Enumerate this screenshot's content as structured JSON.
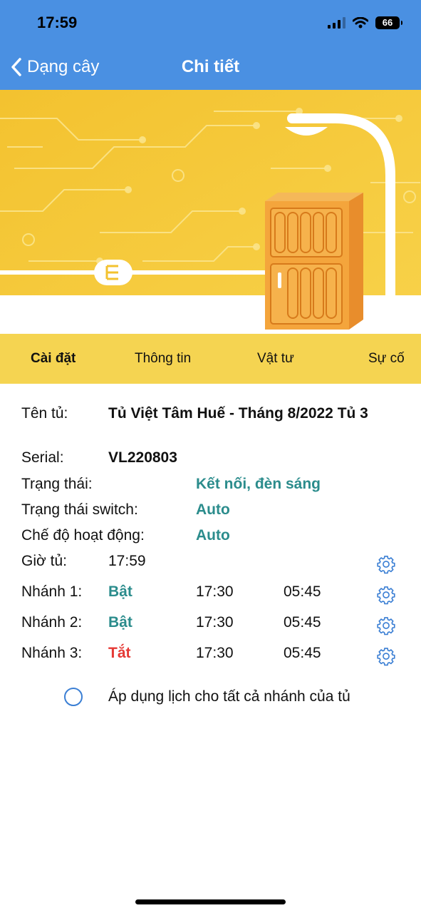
{
  "status_bar": {
    "time": "17:59",
    "battery": "66"
  },
  "nav": {
    "back_label": "Dạng cây",
    "title": "Chi tiết"
  },
  "tabs": [
    {
      "label": "Cài đặt",
      "active": true
    },
    {
      "label": "Thông tin",
      "active": false
    },
    {
      "label": "Vật tư",
      "active": false
    },
    {
      "label": "Sự cố",
      "active": false
    }
  ],
  "details": {
    "name_label": "Tên tủ:",
    "name_value": "Tủ Việt Tâm Huế - Tháng 8/2022 Tủ 3",
    "serial_label": "Serial:",
    "serial_value": "VL220803",
    "status_label": "Trạng thái:",
    "status_value": "Kết nối, đèn sáng",
    "switch_label": "Trạng thái switch:",
    "switch_value": "Auto",
    "mode_label": "Chế độ hoạt động:",
    "mode_value": "Auto",
    "clock_label": "Giờ tủ:",
    "clock_value": "17:59"
  },
  "branches": [
    {
      "label": "Nhánh 1:",
      "state": "Bật",
      "on": "17:30",
      "off": "05:45"
    },
    {
      "label": "Nhánh 2:",
      "state": "Bật",
      "on": "17:30",
      "off": "05:45"
    },
    {
      "label": "Nhánh 3:",
      "state": "Tắt",
      "on": "17:30",
      "off": "05:45"
    }
  ],
  "apply_all_label": "Áp dụng lịch cho tất cả nhánh của tủ",
  "colors": {
    "header": "#4a90e2",
    "tab_bar": "#f5d451",
    "banner": "#f6c93a",
    "teal": "#2b8c8c",
    "red": "#e53935",
    "gear": "#3b7fd4"
  },
  "icons": [
    "back-chevron-icon",
    "signal-icon",
    "wifi-icon",
    "battery-icon",
    "gear-icon",
    "radio-icon",
    "street-lamp-icon",
    "electrical-cabinet-icon",
    "plug-icon"
  ]
}
